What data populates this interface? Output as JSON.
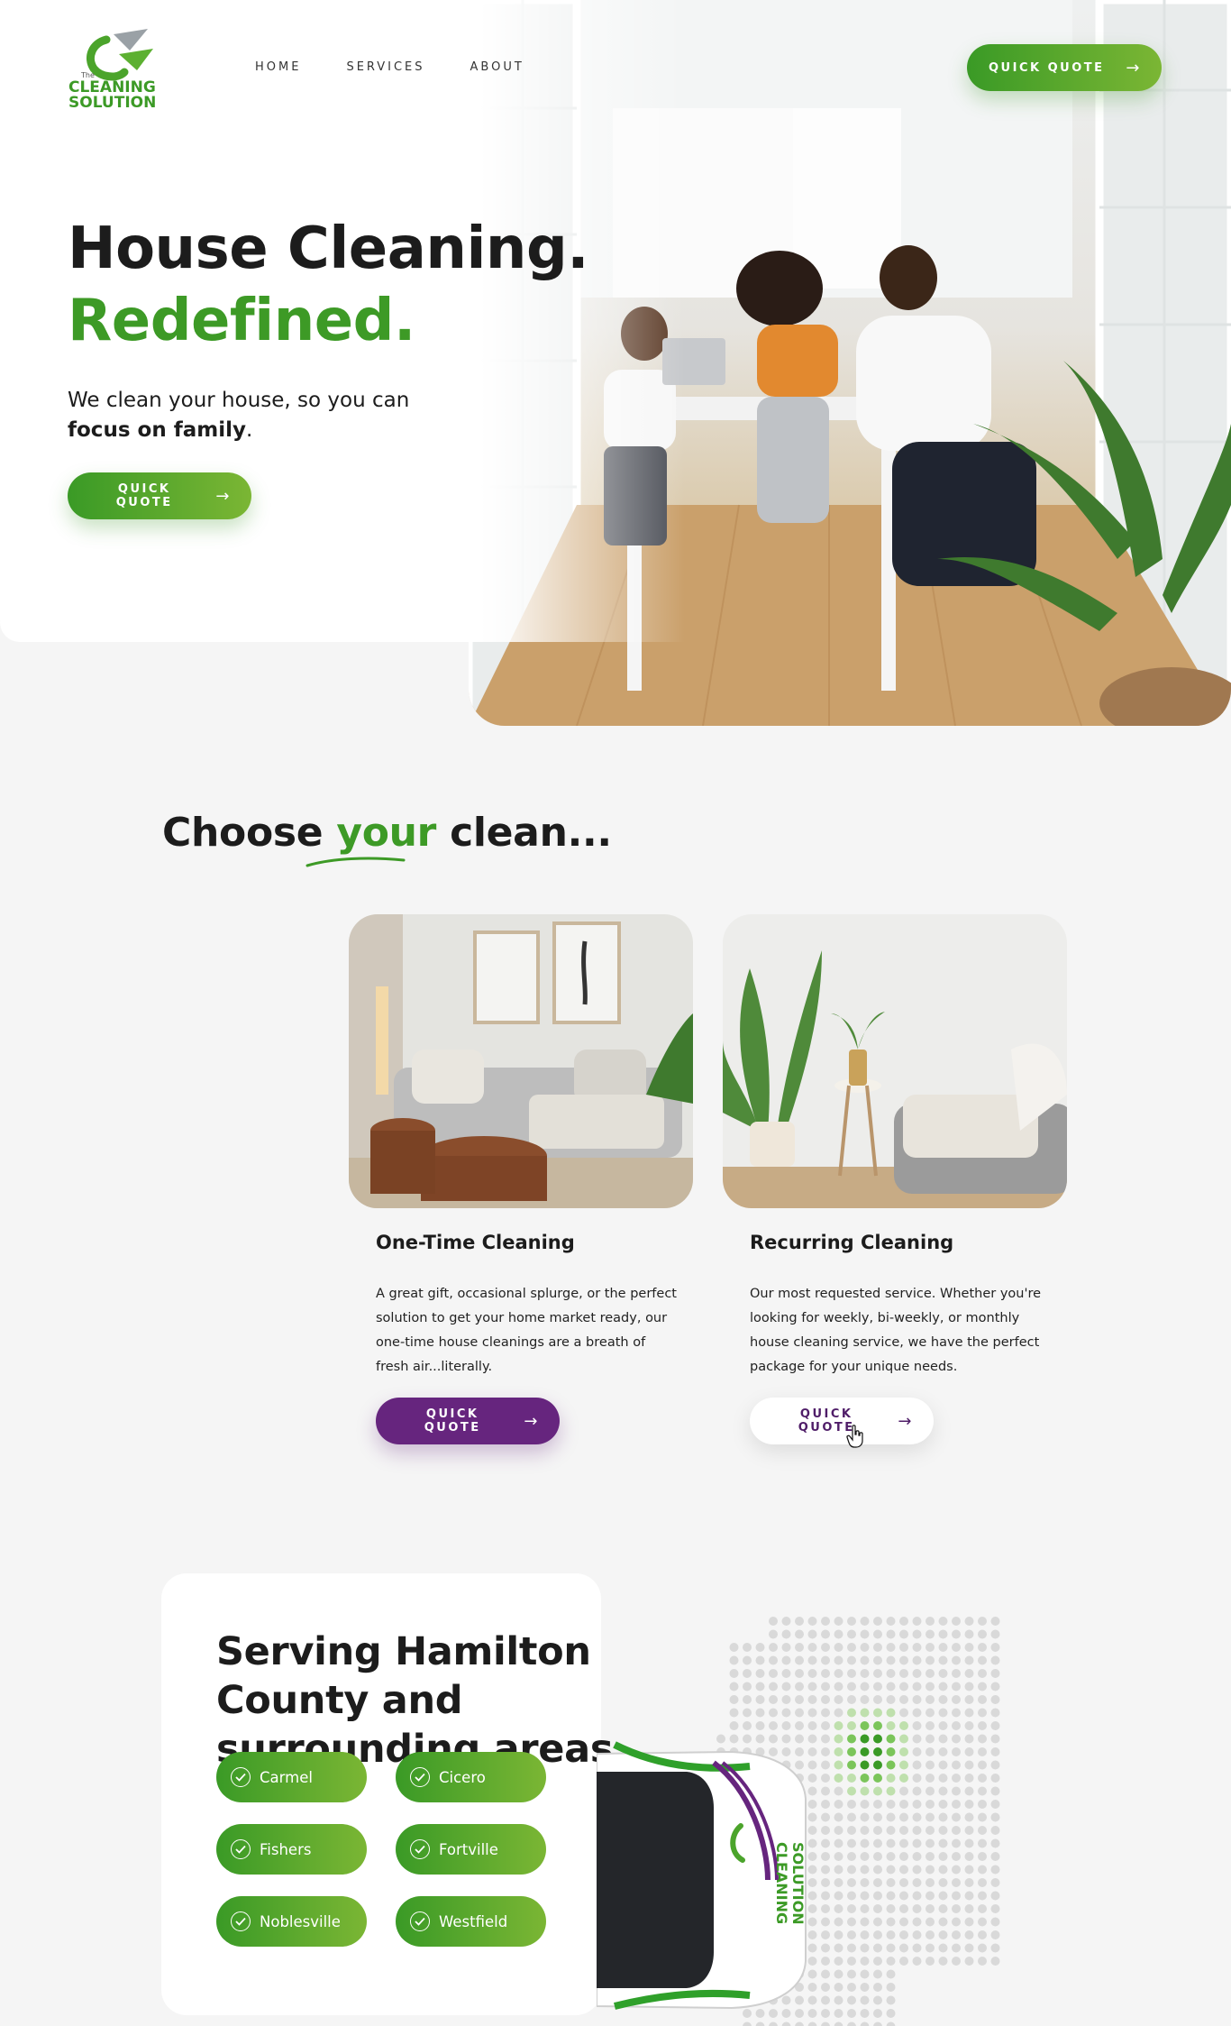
{
  "header": {
    "logo": {
      "small": "The",
      "line1": "CLEANING",
      "line2": "SOLUTION"
    },
    "nav": [
      "HOME",
      "SERVICES",
      "ABOUT"
    ],
    "quote_label": "QUICK QUOTE"
  },
  "hero": {
    "title_line1": "House Cleaning.",
    "title_line2": "Redefined.",
    "subtitle_plain": "We clean your house, so you can",
    "subtitle_bold": "focus on family",
    "subtitle_end": ".",
    "quote_label": "QUICK QUOTE"
  },
  "choose": {
    "title_before": "Choose ",
    "title_accent": "your",
    "title_after": " clean...",
    "cards": [
      {
        "title": "One-Time Cleaning",
        "text": "A great gift, occasional splurge, or the perfect solution to get your home market ready, our one-time house cleanings are a breath of fresh air...literally.",
        "button": "QUICK QUOTE"
      },
      {
        "title": "Recurring Cleaning",
        "text": "Our most requested service. Whether you're looking for weekly, bi-weekly, or monthly house cleaning service, we have the perfect package for your unique needs.",
        "button": "QUICK QUOTE"
      }
    ]
  },
  "serving": {
    "title": "Serving Hamilton County and surrounding areas",
    "areas": [
      "Carmel",
      "Cicero",
      "Fishers",
      "Fortville",
      "Noblesville",
      "Westfield"
    ],
    "van_logo": {
      "line1": "CLEANING",
      "line2": "SOLUTION"
    }
  },
  "colors": {
    "brand_green": "#3d9a26",
    "brand_green_light": "#7bb634",
    "brand_purple": "#66257e",
    "text_dark": "#1c1c1c",
    "background": "#f5f5f5"
  },
  "icons": [
    "arrow-right-icon",
    "check-circle-icon",
    "hand-cursor-icon"
  ]
}
